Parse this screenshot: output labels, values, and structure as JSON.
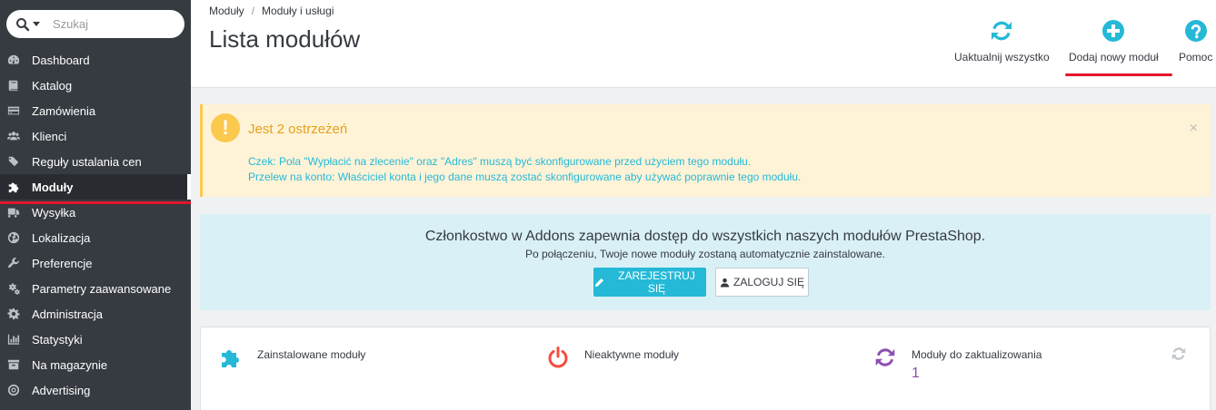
{
  "search": {
    "placeholder": "Szukaj"
  },
  "sidebar": {
    "items": [
      {
        "label": "Dashboard",
        "icon": "dashboard-icon"
      },
      {
        "label": "Katalog",
        "icon": "book-icon"
      },
      {
        "label": "Zamówienia",
        "icon": "credit-card-icon"
      },
      {
        "label": "Klienci",
        "icon": "users-icon"
      },
      {
        "label": "Reguły ustalania cen",
        "icon": "tags-icon"
      },
      {
        "label": "Moduły",
        "icon": "puzzle-icon",
        "active": true
      },
      {
        "label": "Wysyłka",
        "icon": "truck-icon"
      },
      {
        "label": "Lokalizacja",
        "icon": "globe-icon"
      },
      {
        "label": "Preferencje",
        "icon": "wrench-icon"
      },
      {
        "label": "Parametry zaawansowane",
        "icon": "cogs-icon"
      },
      {
        "label": "Administracja",
        "icon": "gear-icon"
      },
      {
        "label": "Statystyki",
        "icon": "bar-chart-icon"
      },
      {
        "label": "Na magazynie",
        "icon": "archive-icon"
      },
      {
        "label": "Advertising",
        "icon": "bullseye-icon"
      }
    ]
  },
  "header": {
    "breadcrumb": [
      "Moduły",
      "Moduły i usługi"
    ],
    "breadcrumb_sep": "/",
    "title": "Lista modułów",
    "toolbar": {
      "update_all": "Uaktualnij wszystko",
      "add_module": "Dodaj nowy moduł",
      "help": "Pomoc"
    }
  },
  "warning": {
    "title": "Jest 2 ostrzeżeń",
    "close": "×",
    "messages": [
      "Czek: Pola \"Wypłacić na zlecenie\" oraz \"Adres\" muszą być skonfigurowane przed użyciem tego modułu.",
      "Przelew na konto: Właściciel konta i jego dane muszą zostać skonfigurowane aby używać poprawnie tego modułu."
    ]
  },
  "addons": {
    "title": "Członkostwo w Addons zapewnia dostęp do wszystkich naszych modułów PrestaShop.",
    "subtitle": "Po połączeniu, Twoje nowe moduły zostaną automatycznie zainstalowane.",
    "register": "ZAREJESTRUJ SIĘ",
    "login": "ZALOGUJ SIĘ"
  },
  "stats": {
    "installed": {
      "label": "Zainstalowane moduły"
    },
    "inactive": {
      "label": "Nieaktywne moduły"
    },
    "to_update": {
      "label": "Moduły do zaktualizowania",
      "value": "1"
    }
  },
  "colors": {
    "sidebar_bg": "#363a41",
    "accent": "#25b9d7",
    "warning": "#fcc94f",
    "highlight_underline": "#e3162b",
    "purple": "#8c4fb1",
    "power_red": "#f54c3e"
  }
}
